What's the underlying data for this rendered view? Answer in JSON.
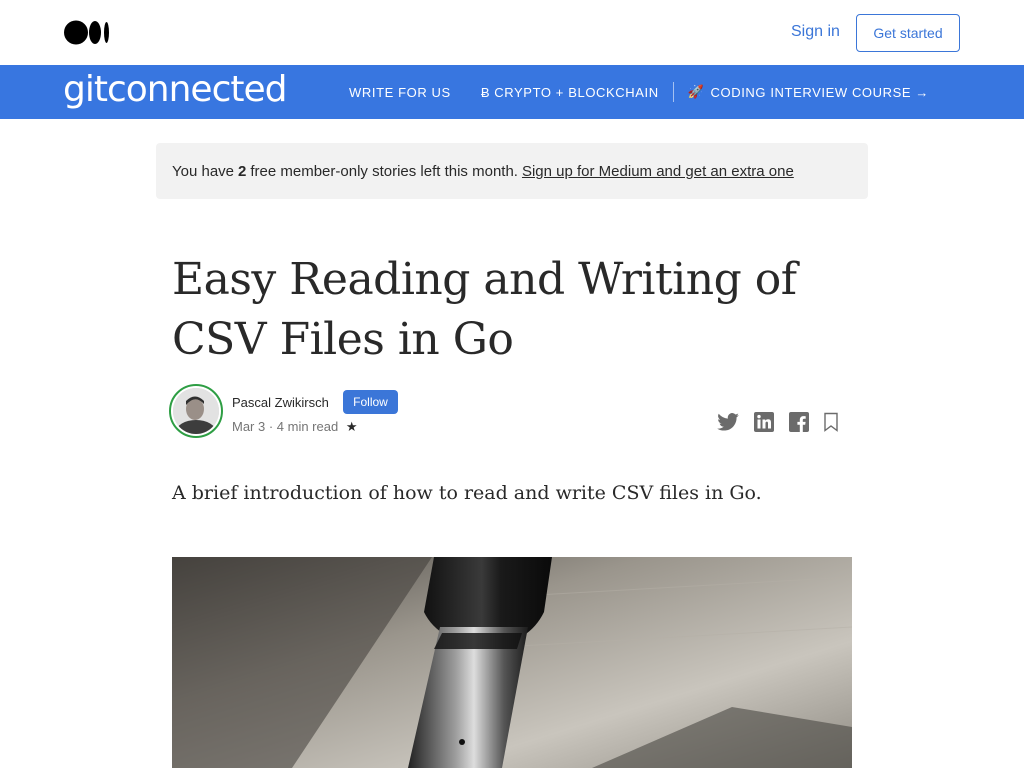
{
  "topbar": {
    "logo_icon": "medium-logo-icon",
    "sign_in": "Sign in",
    "get_started": "Get started"
  },
  "publication": {
    "logo": "gitconnected",
    "nav": [
      {
        "label": "WRITE FOR US"
      },
      {
        "label": "Ƀ CRYPTO + BLOCKCHAIN"
      },
      {
        "label": "CODING INTERVIEW COURSE →",
        "icon": "rocket-icon"
      }
    ],
    "bg_color": "#3876e0"
  },
  "banner": {
    "prefix": "You have",
    "count": "2",
    "suffix": "free member-only stories left this month.",
    "link": "Sign up for Medium and get an extra one"
  },
  "article": {
    "title": "Easy Reading and Writing of CSV Files in Go",
    "author": "Pascal Zwikirsch",
    "follow": "Follow",
    "meta": "Mar 3 · 4 min read",
    "star": "★",
    "subtitle": "A brief introduction of how to read and write CSV files in Go."
  },
  "share_icons": [
    "twitter-icon",
    "linkedin-icon",
    "facebook-icon",
    "bookmark-icon"
  ],
  "accent_color": "#3b76d8"
}
